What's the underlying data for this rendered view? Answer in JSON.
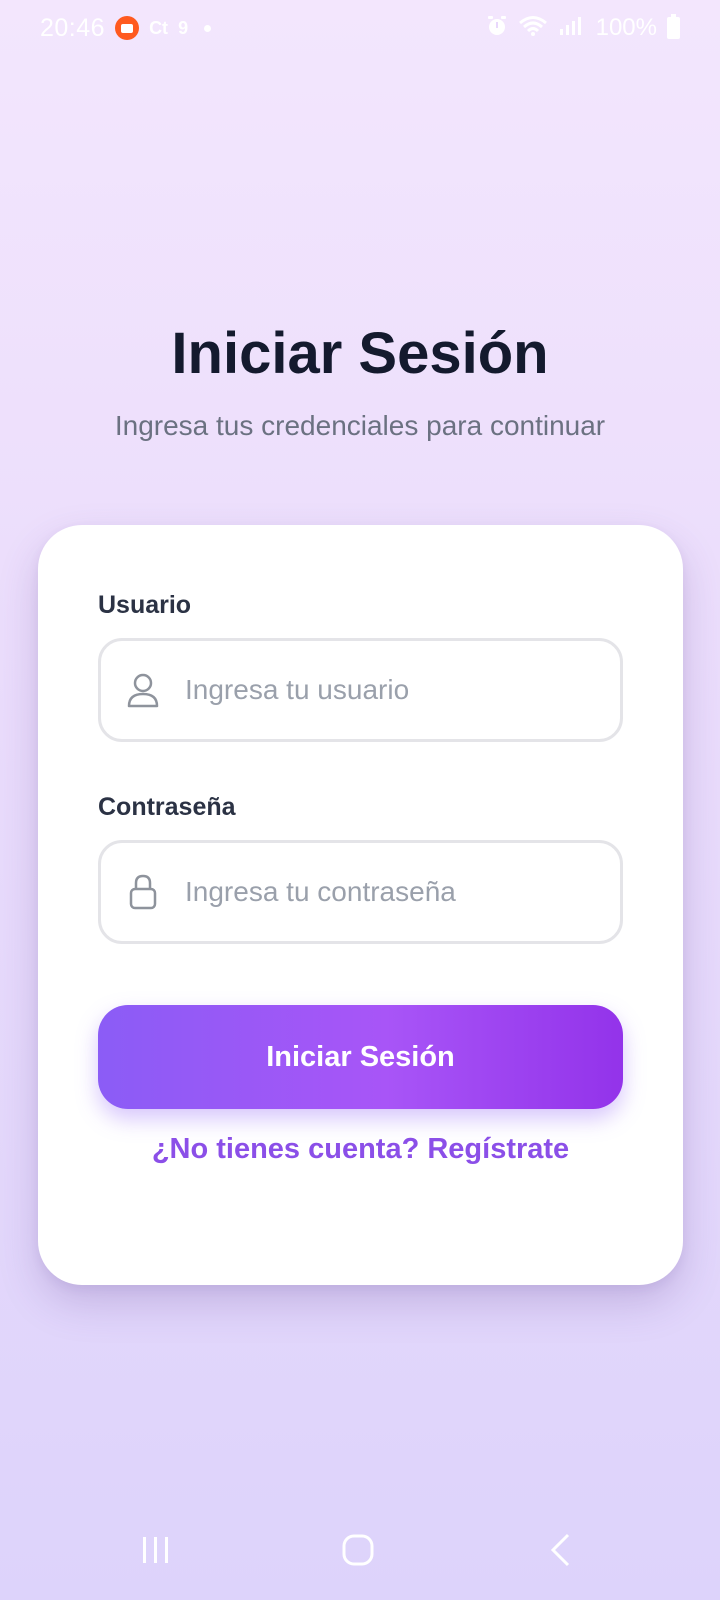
{
  "status_bar": {
    "time": "20:46",
    "app_label": "Ct",
    "temp": "9",
    "battery": "100%",
    "icons": [
      "screen-recorder-icon",
      "alarm-icon",
      "wifi-icon",
      "volte-icon",
      "signal-icon",
      "battery-icon"
    ]
  },
  "header": {
    "title": "Iniciar Sesión",
    "subtitle": "Ingresa tus credenciales para continuar"
  },
  "form": {
    "username_label": "Usuario",
    "username_placeholder": "Ingresa tu usuario",
    "username_value": "",
    "password_label": "Contraseña",
    "password_placeholder": "Ingresa tu contraseña",
    "password_value": "",
    "submit_label": "Iniciar Sesión",
    "register_text": "¿No tienes cuenta? Regístrate"
  },
  "colors": {
    "accent": "#8b5cf6",
    "accent_end": "#9333ea",
    "link": "#8b4fe8",
    "title": "#141a2e"
  },
  "nav": [
    "recent-apps-icon",
    "home-icon",
    "back-icon"
  ]
}
